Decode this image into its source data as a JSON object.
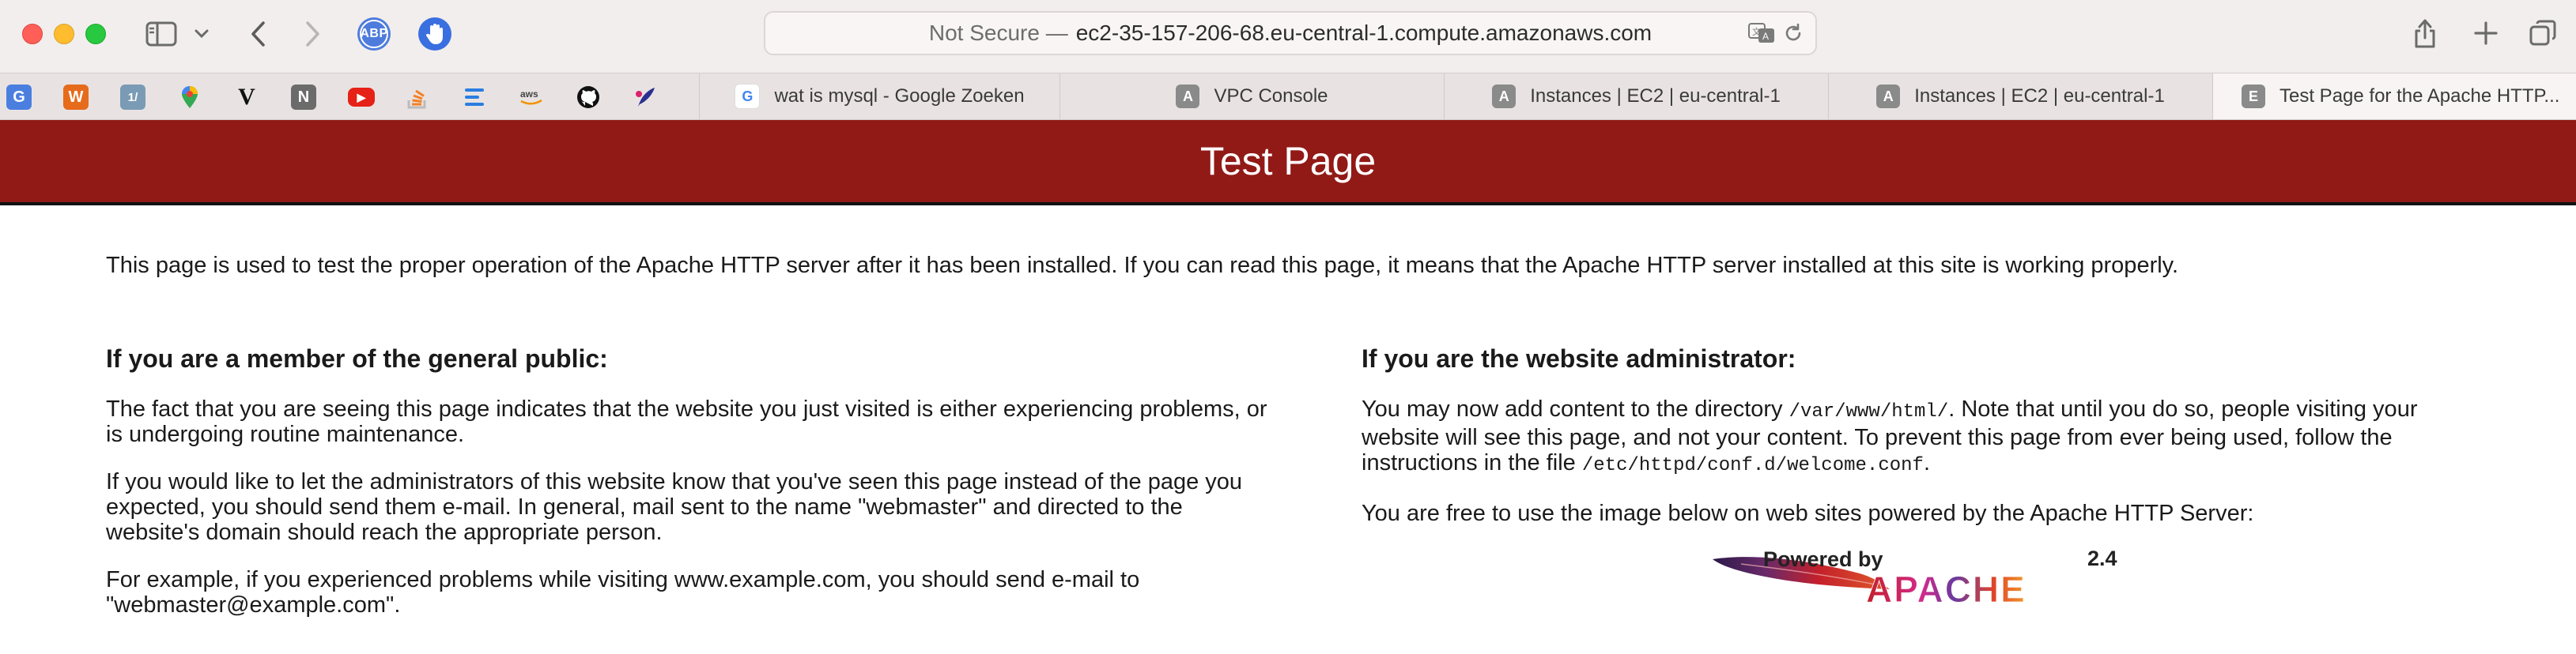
{
  "browser": {
    "url_prefix": "Not Secure —",
    "url_host": "ec2-35-157-206-68.eu-central-1.compute.amazonaws.com",
    "bookmarks": [
      {
        "icon": "google-translate-icon",
        "letter": "G",
        "color": "#4a7fe0"
      },
      {
        "icon": "w-icon",
        "letter": "W",
        "color": "#e66b1b"
      },
      {
        "icon": "calculator-icon",
        "letter": "1/",
        "color": "#7a9bb5"
      },
      {
        "icon": "maps-pin-icon",
        "letter": "",
        "color": "#34a853"
      },
      {
        "icon": "v-icon",
        "letter": "V",
        "color": "#111111"
      },
      {
        "icon": "notion-icon",
        "letter": "N",
        "color": "#6b6b6b"
      },
      {
        "icon": "youtube-icon",
        "letter": "▶",
        "color": "#e62117"
      },
      {
        "icon": "stackoverflow-icon",
        "letter": "≡",
        "color": "#f48024"
      },
      {
        "icon": "list-icon",
        "letter": "☰",
        "color": "#2a7de1"
      },
      {
        "icon": "aws-icon",
        "letter": "aws",
        "color": "#f2eeed"
      },
      {
        "icon": "github-icon",
        "letter": "●",
        "color": "#111111"
      },
      {
        "icon": "feather-icon",
        "letter": "✎",
        "color": "#2b2f8f"
      }
    ],
    "tabs": [
      {
        "label": "wat is mysql - Google Zoeken",
        "badge": "G"
      },
      {
        "label": "VPC Console",
        "badge": "A"
      },
      {
        "label": "Instances | EC2 | eu-central-1",
        "badge": "A"
      },
      {
        "label": "Instances | EC2 | eu-central-1",
        "badge": "A"
      },
      {
        "label": "Test Page for the Apache HTTP...",
        "badge": "E"
      }
    ]
  },
  "page": {
    "title": "Test Page",
    "intro": "This page is used to test the proper operation of the Apache HTTP server after it has been installed. If you can read this page, it means that the Apache HTTP server installed at this site is working properly.",
    "left": {
      "heading": "If you are a member of the general public:",
      "p1": "The fact that you are seeing this page indicates that the website you just visited is either experiencing problems, or is undergoing routine maintenance.",
      "p2": "If you would like to let the administrators of this website know that you've seen this page instead of the page you expected, you should send them e-mail. In general, mail sent to the name \"webmaster\" and directed to the website's domain should reach the appropriate person.",
      "p3": "For example, if you experienced problems while visiting www.example.com, you should send e-mail to \"webmaster@example.com\"."
    },
    "right": {
      "heading": "If you are the website administrator:",
      "p1_a": "You may now add content to the directory ",
      "p1_code1": "/var/www/html/",
      "p1_b": ". Note that until you do so, people visiting your website will see this page, and not your content. To prevent this page from ever being used, follow the instructions in the file ",
      "p1_code2": "/etc/httpd/conf.d/welcome.conf",
      "p1_c": ".",
      "p2": "You are free to use the image below on web sites powered by the Apache HTTP Server:"
    },
    "badge": {
      "powered_by": "Powered by",
      "apache": "APACHE",
      "version": "2.4"
    }
  }
}
